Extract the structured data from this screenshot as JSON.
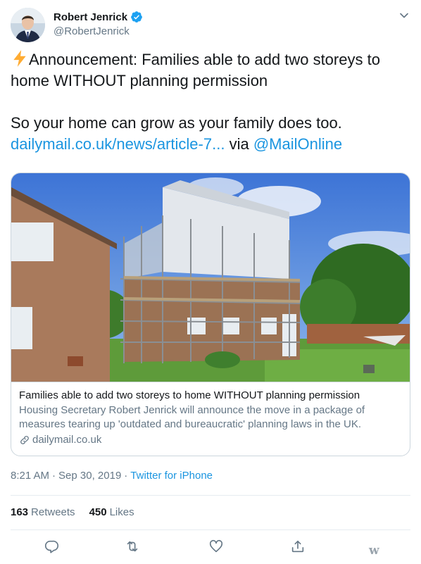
{
  "author": {
    "name": "Robert Jenrick",
    "handle": "@RobertJenrick",
    "verified": true
  },
  "tweet": {
    "line1": "Announcement: Families able to add two storeys to home WITHOUT planning permission",
    "line2": "So your home can grow as your family does too.",
    "link_text": "dailymail.co.uk/news/article-7...",
    "via_word": "via",
    "mention": "@MailOnline"
  },
  "card": {
    "title": "Families able to add two storeys to home WITHOUT planning permission",
    "description": "Housing Secretary Robert Jenrick will announce the move in a package of measures tearing up 'outdated and bureaucratic' planning laws in the UK.",
    "domain": "dailymail.co.uk"
  },
  "meta": {
    "time": "8:21 AM",
    "separator": "·",
    "date": "Sep 30, 2019",
    "source": "Twitter for iPhone"
  },
  "stats": {
    "retweets_count": "163",
    "retweets_label": "Retweets",
    "likes_count": "450",
    "likes_label": "Likes"
  },
  "icons": {
    "verified": "verified-badge-icon",
    "caret": "chevron-down-icon",
    "bolt": "lightning-emoji-icon",
    "link": "link-icon",
    "reply": "reply-icon",
    "retweet": "retweet-icon",
    "like": "heart-icon",
    "share": "share-icon"
  },
  "colors": {
    "accent": "#1b95e0",
    "muted": "#657786",
    "border": "#ccd6dd"
  },
  "watermark": "w"
}
